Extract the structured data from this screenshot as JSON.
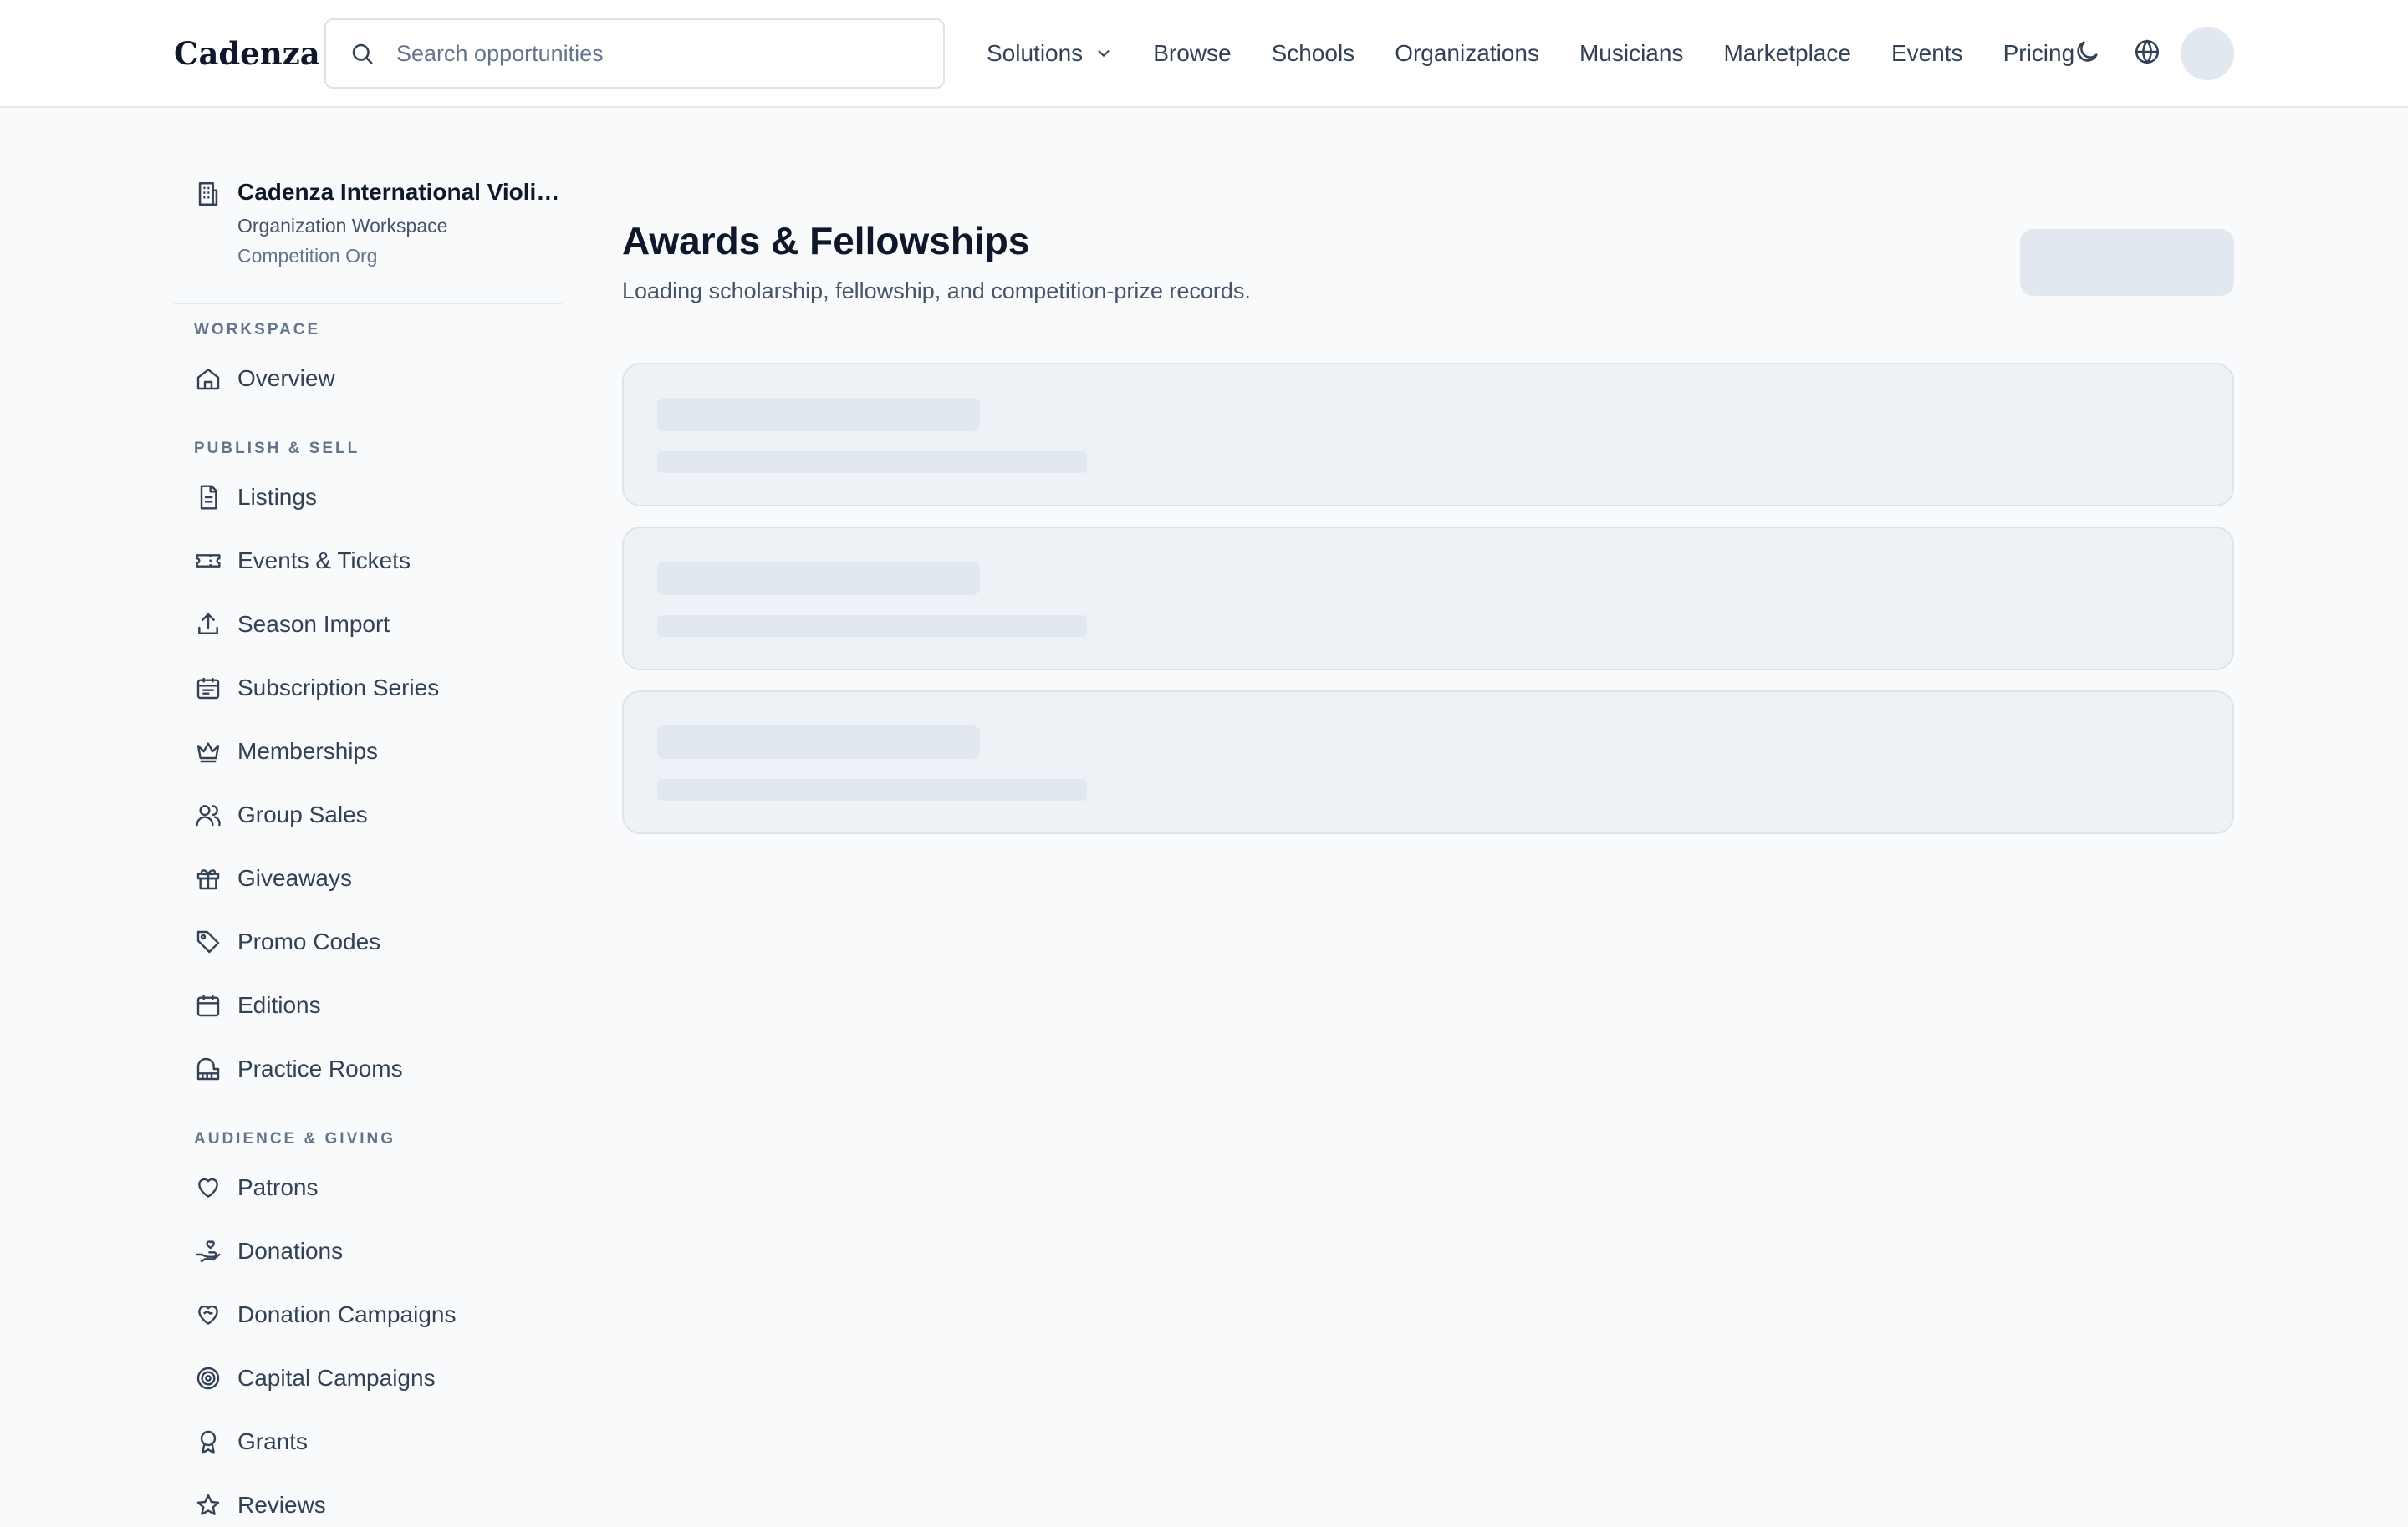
{
  "app": {
    "logo": "Cadenza"
  },
  "search": {
    "placeholder": "Search opportunities",
    "value": ""
  },
  "nav": {
    "items": [
      "Solutions",
      "Browse",
      "Schools",
      "Organizations",
      "Musicians",
      "Marketplace",
      "Events",
      "Pricing"
    ]
  },
  "org": {
    "name": "Cadenza International Violin Competition",
    "workspace": "Organization Workspace",
    "type": "Competition Org"
  },
  "sidebar": {
    "sections": [
      {
        "label": "WORKSPACE",
        "items": [
          {
            "label": "Overview",
            "icon": "home-icon"
          }
        ]
      },
      {
        "label": "PUBLISH & SELL",
        "items": [
          {
            "label": "Listings",
            "icon": "document-icon"
          },
          {
            "label": "Events & Tickets",
            "icon": "ticket-icon"
          },
          {
            "label": "Season Import",
            "icon": "upload-icon"
          },
          {
            "label": "Subscription Series",
            "icon": "calendar-list-icon"
          },
          {
            "label": "Memberships",
            "icon": "crown-icon"
          },
          {
            "label": "Group Sales",
            "icon": "users-icon"
          },
          {
            "label": "Giveaways",
            "icon": "gift-icon"
          },
          {
            "label": "Promo Codes",
            "icon": "tag-icon"
          },
          {
            "label": "Editions",
            "icon": "calendar-icon"
          },
          {
            "label": "Practice Rooms",
            "icon": "piano-icon"
          }
        ]
      },
      {
        "label": "AUDIENCE & GIVING",
        "items": [
          {
            "label": "Patrons",
            "icon": "heart-icon"
          },
          {
            "label": "Donations",
            "icon": "hand-heart-icon"
          },
          {
            "label": "Donation Campaigns",
            "icon": "heart-handshake-icon"
          },
          {
            "label": "Capital Campaigns",
            "icon": "target-icon"
          },
          {
            "label": "Grants",
            "icon": "award-icon"
          },
          {
            "label": "Reviews",
            "icon": "star-icon"
          }
        ]
      }
    ]
  },
  "main": {
    "title": "Awards & Fellowships",
    "subtitle": "Loading scholarship, fellowship, and competition-prize records."
  },
  "colors": {
    "text_primary": "#0f172a",
    "text_secondary": "#475569",
    "skeleton": "#e2e8f0",
    "background": "#f8fafc"
  }
}
